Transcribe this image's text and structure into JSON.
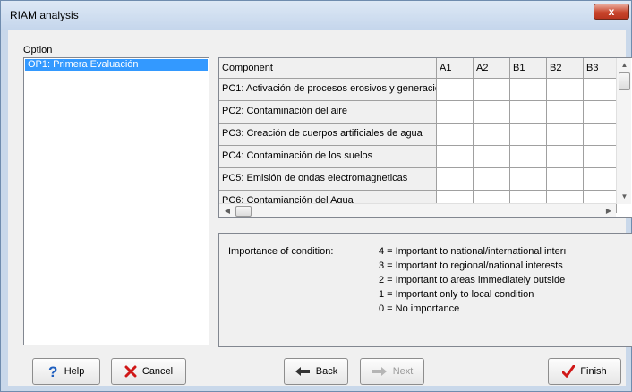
{
  "window": {
    "title": "RIAM analysis",
    "close_glyph": "x"
  },
  "option": {
    "label": "Option",
    "items": [
      "OP1: Primera Evaluación"
    ]
  },
  "grid": {
    "columns": [
      "Component",
      "A1",
      "A2",
      "B1",
      "B2",
      "B3"
    ],
    "rows": [
      "PC1: Activación de procesos erosivos y generació",
      "PC2: Contaminación del aire",
      "PC3: Creación de cuerpos artificiales de agua",
      "PC4: Contaminación de los suelos",
      "PC5: Emisión de ondas electromagneticas",
      "PC6: Contamianción del Agua"
    ]
  },
  "info": {
    "label": "Importance of condition:",
    "lines": [
      "4 = Important to national/international inter\u0000",
      "3 = Important to regional/national interests",
      "2 = Important to areas immediately outside",
      "1 = Important only to local condition",
      "0 = No importance"
    ]
  },
  "buttons": {
    "help": "Help",
    "cancel": "Cancel",
    "back": "Back",
    "next": "Next",
    "finish": "Finish"
  },
  "icons": {
    "help": "question-icon",
    "cancel": "red-x-icon",
    "back": "pointing-hand-left-icon",
    "next": "pointing-hand-right-icon",
    "finish": "check-icon"
  },
  "colors": {
    "selection": "#3399ff",
    "close_button": "#c8452c",
    "help_icon": "#1f5fbf",
    "cancel_icon": "#d01818",
    "finish_icon": "#d01818"
  }
}
